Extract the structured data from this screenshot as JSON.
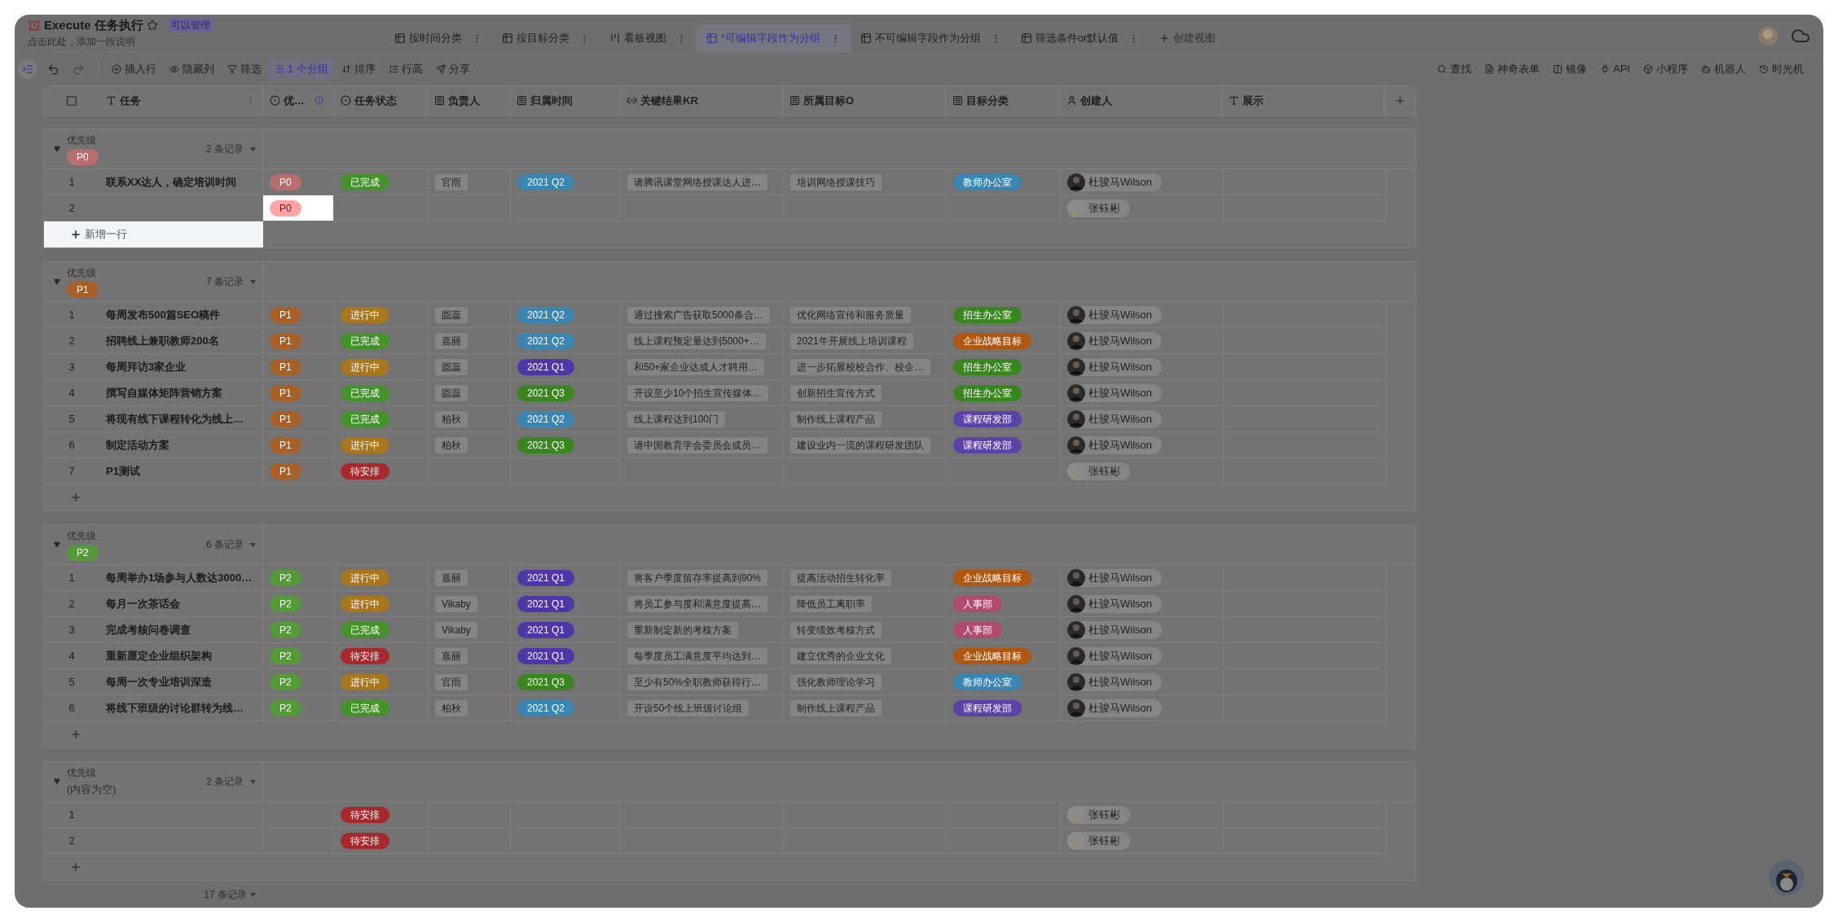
{
  "window": {
    "title": "Execute 任务执行",
    "badge": "可以管理",
    "subtitle": "点击此处，添加一段说明"
  },
  "tabs": [
    {
      "label": "按时间分类",
      "kind": "grid",
      "selected": false
    },
    {
      "label": "按目标分类",
      "kind": "grid",
      "selected": false
    },
    {
      "label": "看板视图",
      "kind": "kanban",
      "selected": false
    },
    {
      "label": "*可编辑字段作为分组",
      "kind": "grid",
      "selected": true
    },
    {
      "label": "不可编辑字段作为分组",
      "kind": "grid",
      "selected": false
    },
    {
      "label": "筛选条件or默认值",
      "kind": "grid",
      "selected": false
    },
    {
      "label": "创建视图",
      "kind": "create",
      "selected": false
    }
  ],
  "toolbar": [
    {
      "label": "插入行",
      "kind": "insert",
      "active": false
    },
    {
      "label": "隐藏列",
      "kind": "hide",
      "active": false
    },
    {
      "label": "筛选",
      "kind": "filter",
      "active": false
    },
    {
      "label": "1 个分组",
      "kind": "group",
      "active": true
    },
    {
      "label": "排序",
      "kind": "sort",
      "active": false
    },
    {
      "label": "行高",
      "kind": "height",
      "active": false
    },
    {
      "label": "分享",
      "kind": "share",
      "active": false
    }
  ],
  "toolbar_right": [
    {
      "label": "查找",
      "kind": "find"
    },
    {
      "label": "神奇表单",
      "kind": "form"
    },
    {
      "label": "镜像",
      "kind": "mirror"
    },
    {
      "label": "API",
      "kind": "api"
    },
    {
      "label": "小程序",
      "kind": "app"
    },
    {
      "label": "机器人",
      "kind": "robot"
    },
    {
      "label": "时光机",
      "kind": "history"
    }
  ],
  "table": {
    "columns": [
      {
        "label": "任务",
        "kind": "text"
      },
      {
        "label": "优…",
        "kind": "select",
        "info": true
      },
      {
        "label": "任务状态",
        "kind": "select",
        "info": false
      },
      {
        "label": "负责人",
        "kind": "lookup"
      },
      {
        "label": "归属时间",
        "kind": "lookup"
      },
      {
        "label": "关键结果KR",
        "kind": "link"
      },
      {
        "label": "所属目标O",
        "kind": "lookup"
      },
      {
        "label": "目标分类",
        "kind": "lookup"
      },
      {
        "label": "创建人",
        "kind": "member"
      },
      {
        "label": "展示",
        "kind": "text"
      }
    ],
    "groups": [
      {
        "field": "优先级",
        "value": {
          "text": "P0",
          "color": "#b86e6e"
        },
        "count": "2 条记录",
        "add_row": {
          "label": "新增一行",
          "highlighted": true
        },
        "rows": [
          {
            "num": "1",
            "task": "联系XX达人，确定培训时间",
            "priority": {
              "text": "P0",
              "color": "#b86e6e"
            },
            "priority_highlighted": false,
            "status": {
              "text": "已完成",
              "color": "#44922a"
            },
            "owner": "官雨",
            "period": {
              "text": "2021 Q2",
              "color": "#3a86b2"
            },
            "kr": "请腾讯课堂网络授课达人进…",
            "objective": "培训网络授课技巧",
            "category": {
              "text": "教师办公室",
              "color": "#3a86b2"
            },
            "creator": {
              "name": "杜骏马Wilson",
              "kind": "photo"
            }
          },
          {
            "num": "2",
            "priority": {
              "text": "P0",
              "color": "#ffa5a5"
            },
            "priority_highlighted": true,
            "creator": {
              "name": "张钰彬",
              "kind": "sketch"
            }
          }
        ]
      },
      {
        "field": "优先级",
        "value": {
          "text": "P1",
          "color": "#a85f28"
        },
        "count": "7 条记录",
        "add_row": {
          "highlighted": false
        },
        "rows": [
          {
            "num": "1",
            "task": "每周发布500篇SEO稿件",
            "priority": {
              "text": "P1",
              "color": "#a85f28"
            },
            "priority_highlighted": false,
            "status": {
              "text": "进行中",
              "color": "#a8761c"
            },
            "owner": "圆蕊",
            "period": {
              "text": "2021 Q2",
              "color": "#3a86b2"
            },
            "kr": "通过搜索广告获取5000条合…",
            "objective": "优化网络宣传和服务质量",
            "category": {
              "text": "招生办公室",
              "color": "#3a861e"
            },
            "creator": {
              "name": "杜骏马Wilson",
              "kind": "photo"
            }
          },
          {
            "num": "2",
            "task": "招聘线上兼职教师200名",
            "priority": {
              "text": "P1",
              "color": "#a85f28"
            },
            "priority_highlighted": false,
            "status": {
              "text": "已完成",
              "color": "#44922a"
            },
            "owner": "嘉丽",
            "period": {
              "text": "2021 Q2",
              "color": "#3a86b2"
            },
            "kr": "线上课程预定量达到5000+…",
            "objective": "2021年开展线上培训课程",
            "category": {
              "text": "企业战略目标",
              "color": "#b0560e"
            },
            "creator": {
              "name": "杜骏马Wilson",
              "kind": "photo"
            }
          },
          {
            "num": "3",
            "task": "每周拜访3家企业",
            "priority": {
              "text": "P1",
              "color": "#a85f28"
            },
            "priority_highlighted": false,
            "status": {
              "text": "进行中",
              "color": "#a8761c"
            },
            "owner": "圆蕊",
            "period": {
              "text": "2021 Q1",
              "color": "#4e36a8"
            },
            "kr": "和50+家企业达成人才聘用…",
            "objective": "进一步拓展校校合作、校企…",
            "category": {
              "text": "招生办公室",
              "color": "#3a861e"
            },
            "creator": {
              "name": "杜骏马Wilson",
              "kind": "photo"
            }
          },
          {
            "num": "4",
            "task": "撰写自媒体矩阵营销方案",
            "priority": {
              "text": "P1",
              "color": "#a85f28"
            },
            "priority_highlighted": false,
            "status": {
              "text": "已完成",
              "color": "#44922a"
            },
            "owner": "圆蕊",
            "period": {
              "text": "2021 Q3",
              "color": "#3a861e"
            },
            "kr": "开设至少10个招生宣传媒体…",
            "objective": "创新招生宣传方式",
            "category": {
              "text": "招生办公室",
              "color": "#3a861e"
            },
            "creator": {
              "name": "杜骏马Wilson",
              "kind": "photo"
            }
          },
          {
            "num": "5",
            "task": "将现有线下课程转化为线上…",
            "priority": {
              "text": "P1",
              "color": "#a85f28"
            },
            "priority_highlighted": false,
            "status": {
              "text": "已完成",
              "color": "#44922a"
            },
            "owner": "柏秋",
            "period": {
              "text": "2021 Q2",
              "color": "#3a86b2"
            },
            "kr": "线上课程达到100门",
            "objective": "制作线上课程产品",
            "category": {
              "text": "课程研发部",
              "color": "#5b42a8"
            },
            "creator": {
              "name": "杜骏马Wilson",
              "kind": "photo"
            }
          },
          {
            "num": "6",
            "task": "制定活动方案",
            "priority": {
              "text": "P1",
              "color": "#a85f28"
            },
            "priority_highlighted": false,
            "status": {
              "text": "进行中",
              "color": "#a8761c"
            },
            "owner": "柏秋",
            "period": {
              "text": "2021 Q3",
              "color": "#3a861e"
            },
            "kr": "请中国教育学会委员会成员…",
            "objective": "建设业内一流的课程研发团队",
            "category": {
              "text": "课程研发部",
              "color": "#5b42a8"
            },
            "creator": {
              "name": "杜骏马Wilson",
              "kind": "photo"
            }
          },
          {
            "num": "7",
            "task": "P1测试",
            "priority": {
              "text": "P1",
              "color": "#a85f28"
            },
            "priority_highlighted": false,
            "status": {
              "text": "待安排",
              "color": "#a8282c"
            },
            "creator": {
              "name": "张钰彬",
              "kind": "sketch"
            }
          }
        ]
      },
      {
        "field": "优先级",
        "value": {
          "text": "P2",
          "color": "#559a38"
        },
        "count": "6 条记录",
        "add_row": {
          "highlighted": false
        },
        "rows": [
          {
            "num": "1",
            "task": "每周举办1场参与人数达3000…",
            "priority": {
              "text": "P2",
              "color": "#559a38"
            },
            "priority_highlighted": false,
            "status": {
              "text": "进行中",
              "color": "#a8761c"
            },
            "owner": "嘉丽",
            "period": {
              "text": "2021 Q1",
              "color": "#4e36a8"
            },
            "kr": "将客户季度留存率提高到90%",
            "objective": "提高活动招生转化率",
            "category": {
              "text": "企业战略目标",
              "color": "#b0560e"
            },
            "creator": {
              "name": "杜骏马Wilson",
              "kind": "photo"
            }
          },
          {
            "num": "2",
            "task": "每月一次茶话会",
            "priority": {
              "text": "P2",
              "color": "#559a38"
            },
            "priority_highlighted": false,
            "status": {
              "text": "进行中",
              "color": "#a8761c"
            },
            "owner": "Vikaby",
            "period": {
              "text": "2021 Q1",
              "color": "#4e36a8"
            },
            "kr": "将员工参与度和满意度提高…",
            "objective": "降低员工离职率",
            "category": {
              "text": "人事部",
              "color": "#b04a70"
            },
            "creator": {
              "name": "杜骏马Wilson",
              "kind": "photo"
            }
          },
          {
            "num": "3",
            "task": "完成考核问卷调查",
            "priority": {
              "text": "P2",
              "color": "#559a38"
            },
            "priority_highlighted": false,
            "status": {
              "text": "已完成",
              "color": "#44922a"
            },
            "owner": "Vikaby",
            "period": {
              "text": "2021 Q1",
              "color": "#4e36a8"
            },
            "kr": "重新制定新的考核方案",
            "objective": "转变绩效考核方式",
            "category": {
              "text": "人事部",
              "color": "#b04a70"
            },
            "creator": {
              "name": "杜骏马Wilson",
              "kind": "photo"
            }
          },
          {
            "num": "4",
            "task": "重新厘定企业组织架构",
            "priority": {
              "text": "P2",
              "color": "#559a38"
            },
            "priority_highlighted": false,
            "status": {
              "text": "待安排",
              "color": "#a8282c"
            },
            "owner": "嘉丽",
            "period": {
              "text": "2021 Q1",
              "color": "#4e36a8"
            },
            "kr": "每季度员工满意度平均达到…",
            "objective": "建立优秀的企业文化",
            "category": {
              "text": "企业战略目标",
              "color": "#b0560e"
            },
            "creator": {
              "name": "杜骏马Wilson",
              "kind": "photo"
            }
          },
          {
            "num": "5",
            "task": "每周一次专业培训深造",
            "priority": {
              "text": "P2",
              "color": "#559a38"
            },
            "priority_highlighted": false,
            "status": {
              "text": "进行中",
              "color": "#a8761c"
            },
            "owner": "官雨",
            "period": {
              "text": "2021 Q3",
              "color": "#3a861e"
            },
            "kr": "至少有50%全职教师获得行…",
            "objective": "强化教师理论学习",
            "category": {
              "text": "教师办公室",
              "color": "#3a86b2"
            },
            "creator": {
              "name": "杜骏马Wilson",
              "kind": "photo"
            }
          },
          {
            "num": "6",
            "task": "将线下班级的讨论群转为线…",
            "priority": {
              "text": "P2",
              "color": "#559a38"
            },
            "priority_highlighted": false,
            "status": {
              "text": "已完成",
              "color": "#44922a"
            },
            "owner": "柏秋",
            "period": {
              "text": "2021 Q2",
              "color": "#3a86b2"
            },
            "kr": "开设50个线上班级讨论组",
            "objective": "制作线上课程产品",
            "category": {
              "text": "课程研发部",
              "color": "#5b42a8"
            },
            "creator": {
              "name": "杜骏马Wilson",
              "kind": "photo"
            }
          }
        ]
      },
      {
        "field": "优先级",
        "empty_text": "(内容为空)",
        "count": "2 条记录",
        "add_row": {
          "highlighted": false
        },
        "rows": [
          {
            "num": "1",
            "priority_highlighted": false,
            "status": {
              "text": "待安排",
              "color": "#a8282c"
            },
            "creator": {
              "name": "张钰彬",
              "kind": "sketch"
            }
          },
          {
            "num": "2",
            "priority_highlighted": false,
            "status": {
              "text": "待安排",
              "color": "#a8282c"
            },
            "creator": {
              "name": "张钰彬",
              "kind": "sketch"
            }
          }
        ]
      }
    ],
    "total": "17 条记录",
    "select_all": {
      "checked": false
    }
  }
}
